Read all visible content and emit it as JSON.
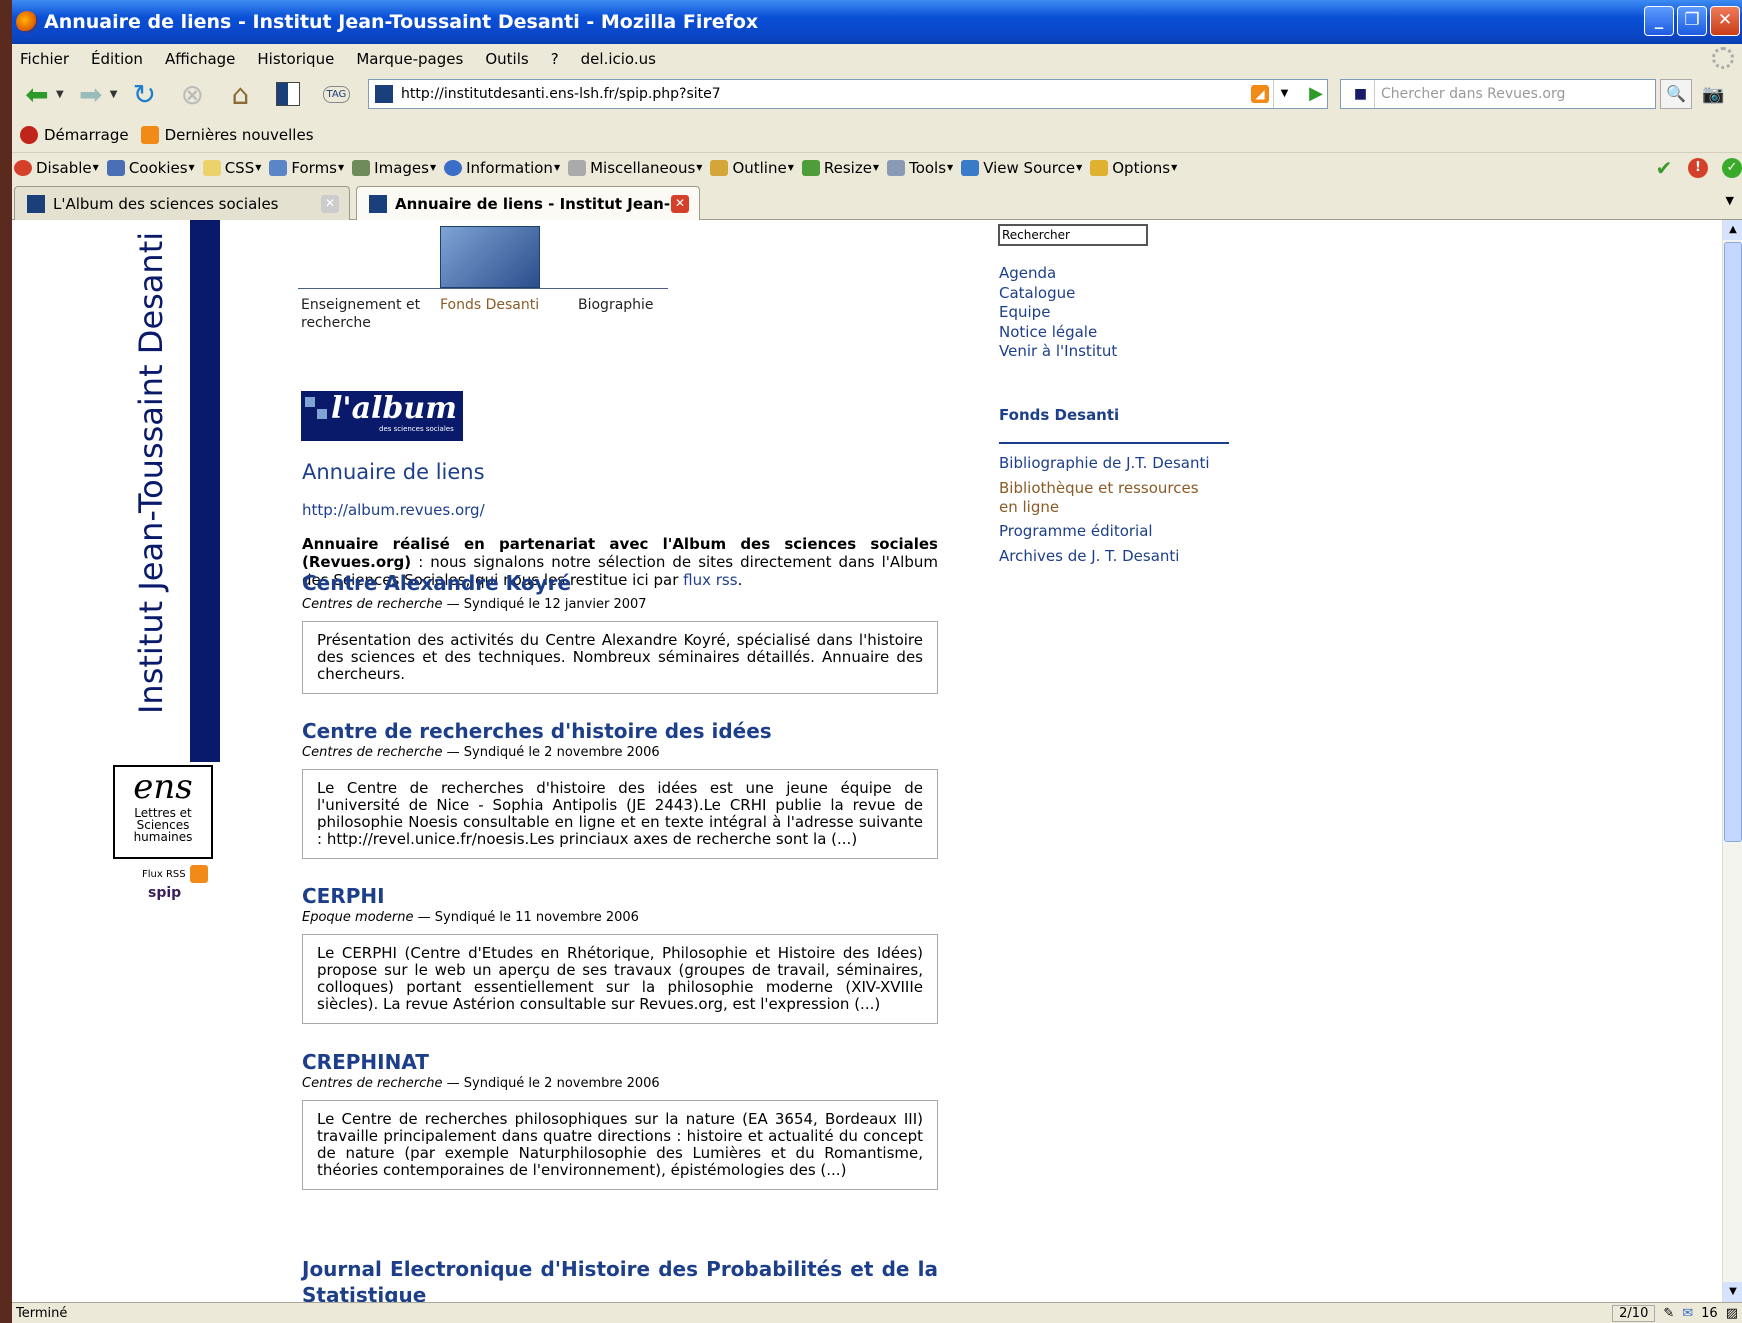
{
  "window": {
    "title": "Annuaire de liens - Institut Jean-Toussaint Desanti - Mozilla Firefox",
    "minimize": "_",
    "restore": "❐",
    "close": "✕"
  },
  "menu": [
    "Fichier",
    "Édition",
    "Affichage",
    "Historique",
    "Marque-pages",
    "Outils",
    "?",
    "del.icio.us"
  ],
  "nav": {
    "url": "http://institutdesanti.ens-lsh.fr/spip.php?site7",
    "search_placeholder": "Chercher dans Revues.org",
    "tag_label": "TAG"
  },
  "bookmarks": [
    {
      "label": "Démarrage",
      "color": "#c0241a"
    },
    {
      "label": "Dernières nouvelles",
      "color": "#f28a18"
    }
  ],
  "devbar": [
    {
      "label": "Disable",
      "color": "#d5402b"
    },
    {
      "label": "Cookies",
      "color": "#4a6fb5"
    },
    {
      "label": "CSS",
      "color": "#e9d36a"
    },
    {
      "label": "Forms",
      "color": "#5a86c8"
    },
    {
      "label": "Images",
      "color": "#6f8b5a"
    },
    {
      "label": "Information",
      "color": "#3b6ec8"
    },
    {
      "label": "Miscellaneous",
      "color": "#aaaaaa"
    },
    {
      "label": "Outline",
      "color": "#d4a63a"
    },
    {
      "label": "Resize",
      "color": "#4e9c3a"
    },
    {
      "label": "Tools",
      "color": "#8a9ab5"
    },
    {
      "label": "View Source",
      "color": "#3a7bc8"
    },
    {
      "label": "Options",
      "color": "#e0b030"
    }
  ],
  "tabs": [
    {
      "label": "L'Album des sciences sociales"
    },
    {
      "label": "Annuaire de liens - Institut Jean-..."
    }
  ],
  "page": {
    "side_title": "Institut Jean-Toussaint Desanti",
    "ens_logo_big": "ens",
    "ens_logo_small": "Lettres et Sciences humaines",
    "flux_rss": "Flux RSS",
    "spip": "spip",
    "topnav": [
      "Enseignement et recherche",
      "Fonds Desanti",
      "Biographie"
    ],
    "album_logo": {
      "big": "l'album",
      "small": "des sciences sociales"
    },
    "title": "Annuaire de liens",
    "site_url": "http://album.revues.org/",
    "intro_bold": "Annuaire réalisé en partenariat avec l'Album des sciences sociales (Revues.org)",
    "intro_text": " : nous signalons notre sélection de sites directement dans l'Album des Sciences Sociales, qui nous les restitue ici par ",
    "intro_link": "flux rss",
    "intro_end": ".",
    "entries": [
      {
        "title": "Centre Alexandre Koyré",
        "category": "Centres de recherche",
        "date": " — Syndiqué le 12 janvier 2007",
        "description": "Présentation des activités du Centre Alexandre Koyré, spécialisé dans l'histoire des sciences et des techniques. Nombreux séminaires détaillés. Annuaire des chercheurs."
      },
      {
        "title": "Centre de recherches d'histoire des idées",
        "category": "Centres de recherche",
        "date": " — Syndiqué le 2 novembre 2006",
        "description": "Le Centre de recherches d'histoire des idées est une jeune équipe de l'université de Nice - Sophia Antipolis (JE 2443).Le CRHI publie la revue de philosophie Noesis consultable en ligne et en texte intégral à l'adresse suivante : http://revel.unice.fr/noesis.Les princiaux axes de recherche sont la (...)"
      },
      {
        "title": "CERPHI",
        "category": "Epoque moderne",
        "date": " — Syndiqué le 11 novembre 2006",
        "description": "Le CERPHI (Centre d'Etudes en Rhétorique, Philosophie et Histoire des Idées) propose sur le web un aperçu de ses travaux (groupes de travail, séminaires, colloques) portant essentiellement sur la philosophie moderne (XIV-XVIIIe siècles). La revue Astérion consultable sur Revues.org, est l'expression (...)"
      },
      {
        "title": "CREPHINAT",
        "category": "Centres de recherche",
        "date": " — Syndiqué le 2 novembre 2006",
        "description": "Le Centre de recherches philosophiques sur la nature (EA 3654, Bordeaux III) travaille principalement dans quatre directions : histoire et actualité du concept de nature (par exemple Naturphilosophie des Lumières et du Romantisme, théories contemporaines de l'environnement), épistémologies des (...)"
      }
    ],
    "last_entry_title": "Journal Electronique d'Histoire des Probabilités et de la Statistique",
    "right": {
      "search_value": "Rechercher",
      "links": [
        "Agenda",
        "Catalogue",
        "Equipe",
        "Notice légale",
        "Venir à l'Institut"
      ],
      "heading": "Fonds Desanti",
      "sublinks": [
        "Bibliographie de J.T. Desanti",
        "Bibliothèque et ressources en ligne",
        "Programme éditorial",
        "Archives de J. T. Desanti"
      ]
    }
  },
  "status": {
    "text": "Terminé",
    "pages": "2/10",
    "mail_count": "16"
  }
}
